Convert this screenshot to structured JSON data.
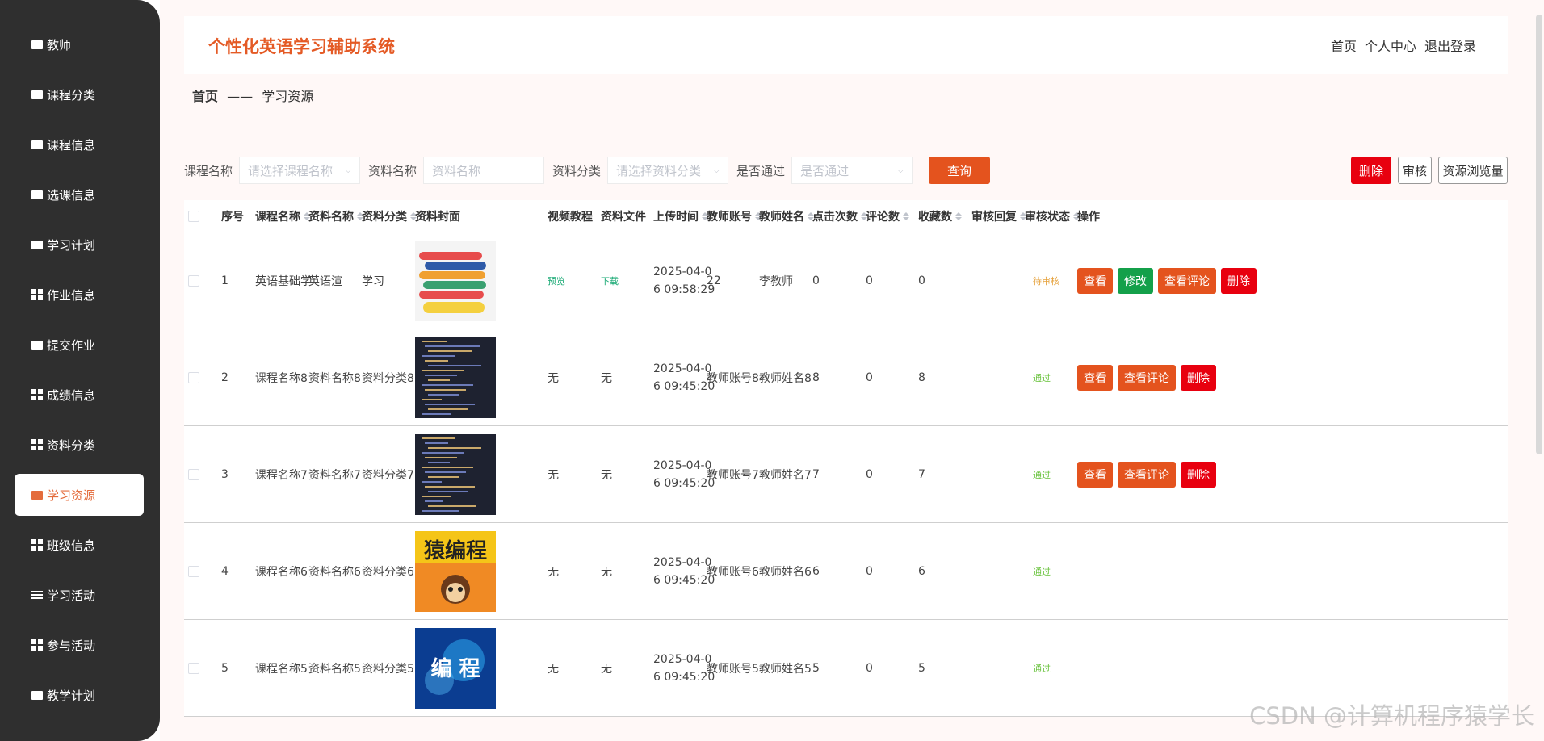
{
  "sidebar": {
    "items": [
      {
        "label": "教师",
        "icon": "briefcase-icon"
      },
      {
        "label": "课程分类",
        "icon": "folder-icon"
      },
      {
        "label": "课程信息",
        "icon": "book-icon"
      },
      {
        "label": "选课信息",
        "icon": "ticket-icon"
      },
      {
        "label": "学习计划",
        "icon": "clipboard-icon"
      },
      {
        "label": "作业信息",
        "icon": "grid-icon"
      },
      {
        "label": "提交作业",
        "icon": "monitor-icon"
      },
      {
        "label": "成绩信息",
        "icon": "grid-icon"
      },
      {
        "label": "资料分类",
        "icon": "grid-icon"
      },
      {
        "label": "学习资源",
        "icon": "library-icon"
      },
      {
        "label": "班级信息",
        "icon": "grid-icon"
      },
      {
        "label": "学习活动",
        "icon": "list-icon"
      },
      {
        "label": "参与活动",
        "icon": "grid-icon"
      },
      {
        "label": "教学计划",
        "icon": "chart-icon"
      }
    ],
    "active_index": 9
  },
  "header": {
    "title": "个性化英语学习辅助系统",
    "links": [
      "首页",
      "个人中心",
      "退出登录"
    ]
  },
  "breadcrumb": {
    "home": "首页",
    "separator": "——",
    "current": "学习资源"
  },
  "search": {
    "course_label": "课程名称",
    "course_placeholder": "请选择课程名称",
    "name_label": "资料名称",
    "name_placeholder": "资料名称",
    "category_label": "资料分类",
    "category_placeholder": "请选择资料分类",
    "passed_label": "是否通过",
    "passed_placeholder": "是否通过",
    "query_button": "查询"
  },
  "actions": {
    "delete": "删除",
    "audit": "审核",
    "views": "资源浏览量"
  },
  "table": {
    "headers": {
      "index": "序号",
      "course": "课程名称",
      "name": "资料名称",
      "category": "资料分类",
      "cover": "资料封面",
      "video": "视频教程",
      "file": "资料文件",
      "upload_time": "上传时间",
      "teacher_account": "教师账号",
      "teacher_name": "教师姓名",
      "clicks": "点击次数",
      "comments": "评论数",
      "favorites": "收藏数",
      "audit_reply": "审核回复",
      "audit_status": "审核状态",
      "ops": "操作"
    },
    "rows": [
      {
        "index": "1",
        "course": "英语基础学",
        "name": "英语渲",
        "category": "学习",
        "cover": "books",
        "video": "预览",
        "file": "下载",
        "time1": "2025-04-0",
        "time2": "6 09:58:29",
        "account": "22",
        "teacher": "李教师",
        "clicks": "0",
        "comments": "0",
        "favorites": "0",
        "status": "待审核",
        "ops": [
          "查看",
          "修改",
          "查看评论",
          "删除"
        ]
      },
      {
        "index": "2",
        "course": "课程名称8",
        "name": "资料名称8",
        "category": "资料分类8",
        "cover": "code",
        "video": "无",
        "file": "无",
        "time1": "2025-04-0",
        "time2": "6 09:45:20",
        "account": "教师账号8",
        "teacher": "教师姓名8",
        "clicks": "8",
        "comments": "0",
        "favorites": "8",
        "status": "通过",
        "ops": [
          "查看",
          "查看评论",
          "删除"
        ]
      },
      {
        "index": "3",
        "course": "课程名称7",
        "name": "资料名称7",
        "category": "资料分类7",
        "cover": "code",
        "video": "无",
        "file": "无",
        "time1": "2025-04-0",
        "time2": "6 09:45:20",
        "account": "教师账号7",
        "teacher": "教师姓名7",
        "clicks": "7",
        "comments": "0",
        "favorites": "7",
        "status": "通过",
        "ops": [
          "查看",
          "查看评论",
          "删除"
        ]
      },
      {
        "index": "4",
        "course": "课程名称6",
        "name": "资料名称6",
        "category": "资料分类6",
        "cover": "monkey",
        "cover_text": "猿编程",
        "video": "无",
        "file": "无",
        "time1": "2025-04-0",
        "time2": "6 09:45:20",
        "account": "教师账号6",
        "teacher": "教师姓名6",
        "clicks": "6",
        "comments": "0",
        "favorites": "6",
        "status": "通过",
        "ops": []
      },
      {
        "index": "5",
        "course": "课程名称5",
        "name": "资料名称5",
        "category": "资料分类5",
        "cover": "blue",
        "cover_text": "编 程",
        "video": "无",
        "file": "无",
        "time1": "2025-04-0",
        "time2": "6 09:45:20",
        "account": "教师账号5",
        "teacher": "教师姓名5",
        "clicks": "5",
        "comments": "0",
        "favorites": "5",
        "status": "通过",
        "ops": []
      }
    ]
  },
  "watermark": "CSDN @计算机程序猿学长",
  "colors": {
    "accent": "#e4531e",
    "sidebar": "#2f2f2f",
    "danger": "#e8000f",
    "success": "#14a04a"
  }
}
